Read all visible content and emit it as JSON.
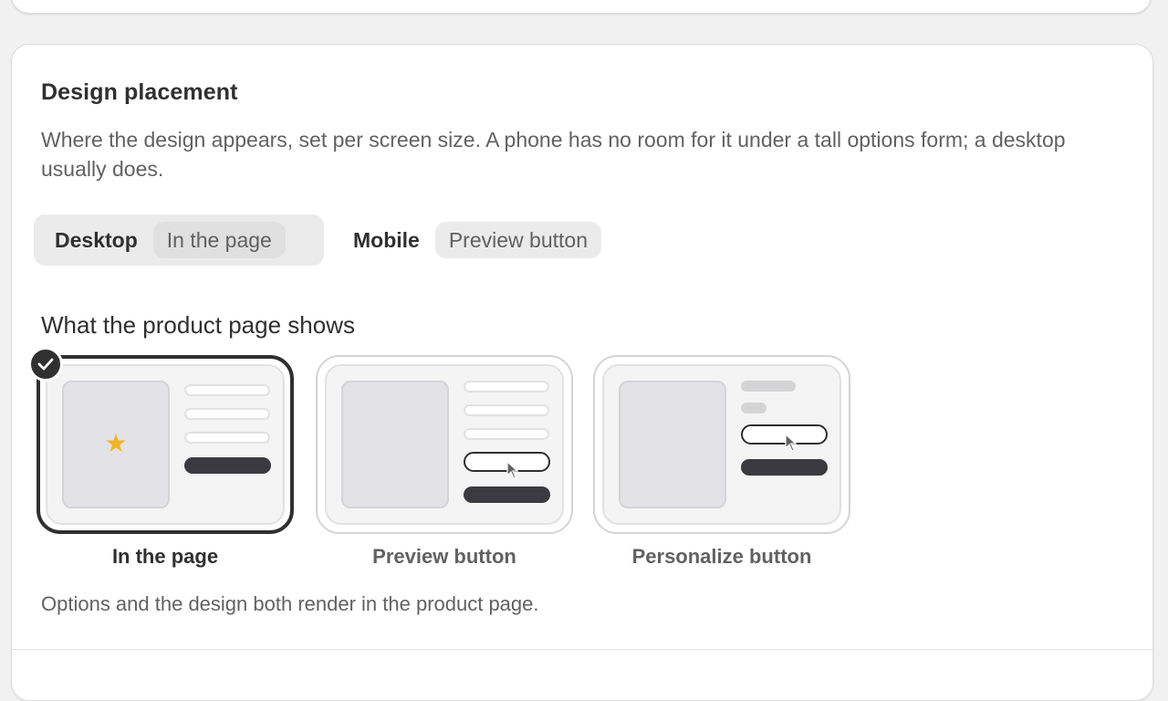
{
  "section": {
    "title": "Design placement",
    "description": "Where the design appears, set per screen size. A phone has no room for it under a tall options form; a desktop usually does."
  },
  "devices": [
    {
      "label": "Desktop",
      "value": "In the page",
      "active": true
    },
    {
      "label": "Mobile",
      "value": "Preview button",
      "active": false
    }
  ],
  "product_page": {
    "heading": "What the product page shows",
    "options": [
      {
        "label": "In the page",
        "selected": true
      },
      {
        "label": "Preview button",
        "selected": false
      },
      {
        "label": "Personalize button",
        "selected": false
      }
    ],
    "helper_text": "Options and the design both render in the product page."
  },
  "colors": {
    "selected_border": "#303030",
    "star": "#f0b429",
    "primary_bar": "#3a3a40",
    "background": "#f1f1f1"
  },
  "icons": [
    "checkmark-icon",
    "star-icon",
    "cursor-icon"
  ]
}
